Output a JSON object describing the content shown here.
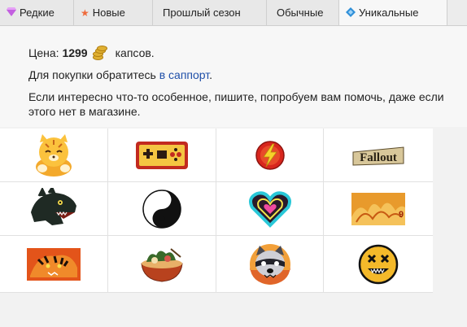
{
  "tabs": [
    {
      "label": "Редкие",
      "icon": "diamond-icon"
    },
    {
      "label": "Новые",
      "icon": "star-icon"
    },
    {
      "label": "Прошлый сезон",
      "icon": ""
    },
    {
      "label": "Обычные",
      "icon": ""
    },
    {
      "label": "Уникальные",
      "icon": "blue-diamond-icon"
    }
  ],
  "active_tab": "Уникальные",
  "price": {
    "prefix": "Цена:",
    "amount": "1299",
    "unit": "капсов."
  },
  "contact": {
    "text": "Для покупки обратитесь",
    "link": "в саппорт",
    "suffix": "."
  },
  "note": "Если интересно что-то особенное, пишите, попробуем вам помочь, даже если этого нет в магазине.",
  "items": [
    {
      "icon": "tiger-cub-icon"
    },
    {
      "icon": "game-controller-icon"
    },
    {
      "icon": "flash-logo-icon"
    },
    {
      "icon": "fallout-logo-icon"
    },
    {
      "icon": "godzilla-head-icon"
    },
    {
      "icon": "yin-yang-icon"
    },
    {
      "icon": "neon-heart-icon"
    },
    {
      "icon": "fire-art-icon"
    },
    {
      "icon": "tiger-fire-icon"
    },
    {
      "icon": "ramen-bowl-icon"
    },
    {
      "icon": "raccoon-icon"
    },
    {
      "icon": "skull-smiley-icon"
    }
  ],
  "colors": {
    "link": "#1f4fa8",
    "coin": "#e0b032"
  }
}
